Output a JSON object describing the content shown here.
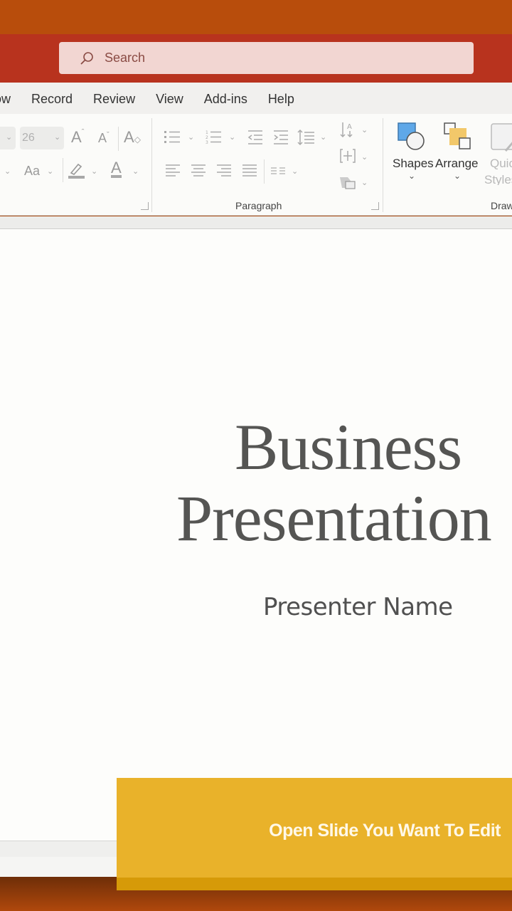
{
  "search": {
    "placeholder": "Search"
  },
  "tabs": [
    "ow",
    "Record",
    "Review",
    "View",
    "Add-ins",
    "Help"
  ],
  "ribbon": {
    "font_size_value": "26",
    "change_case_label": "Aa",
    "paragraph_group_label": "Paragraph",
    "drawing_group_label": "Draw",
    "shapes_label": "Shapes",
    "arrange_label": "Arrange",
    "quick_styles_label_line1": "Quic",
    "quick_styles_label_line2": "Styles"
  },
  "slide": {
    "title_line1": "Business",
    "title_line2": "Presentation",
    "subtitle": "Presenter Name"
  },
  "banner": {
    "text": "Open Slide You Want To Edit",
    "color": "#e9b22a"
  },
  "colors": {
    "titlebar": "#b8331e",
    "background": "#b84d0c"
  }
}
